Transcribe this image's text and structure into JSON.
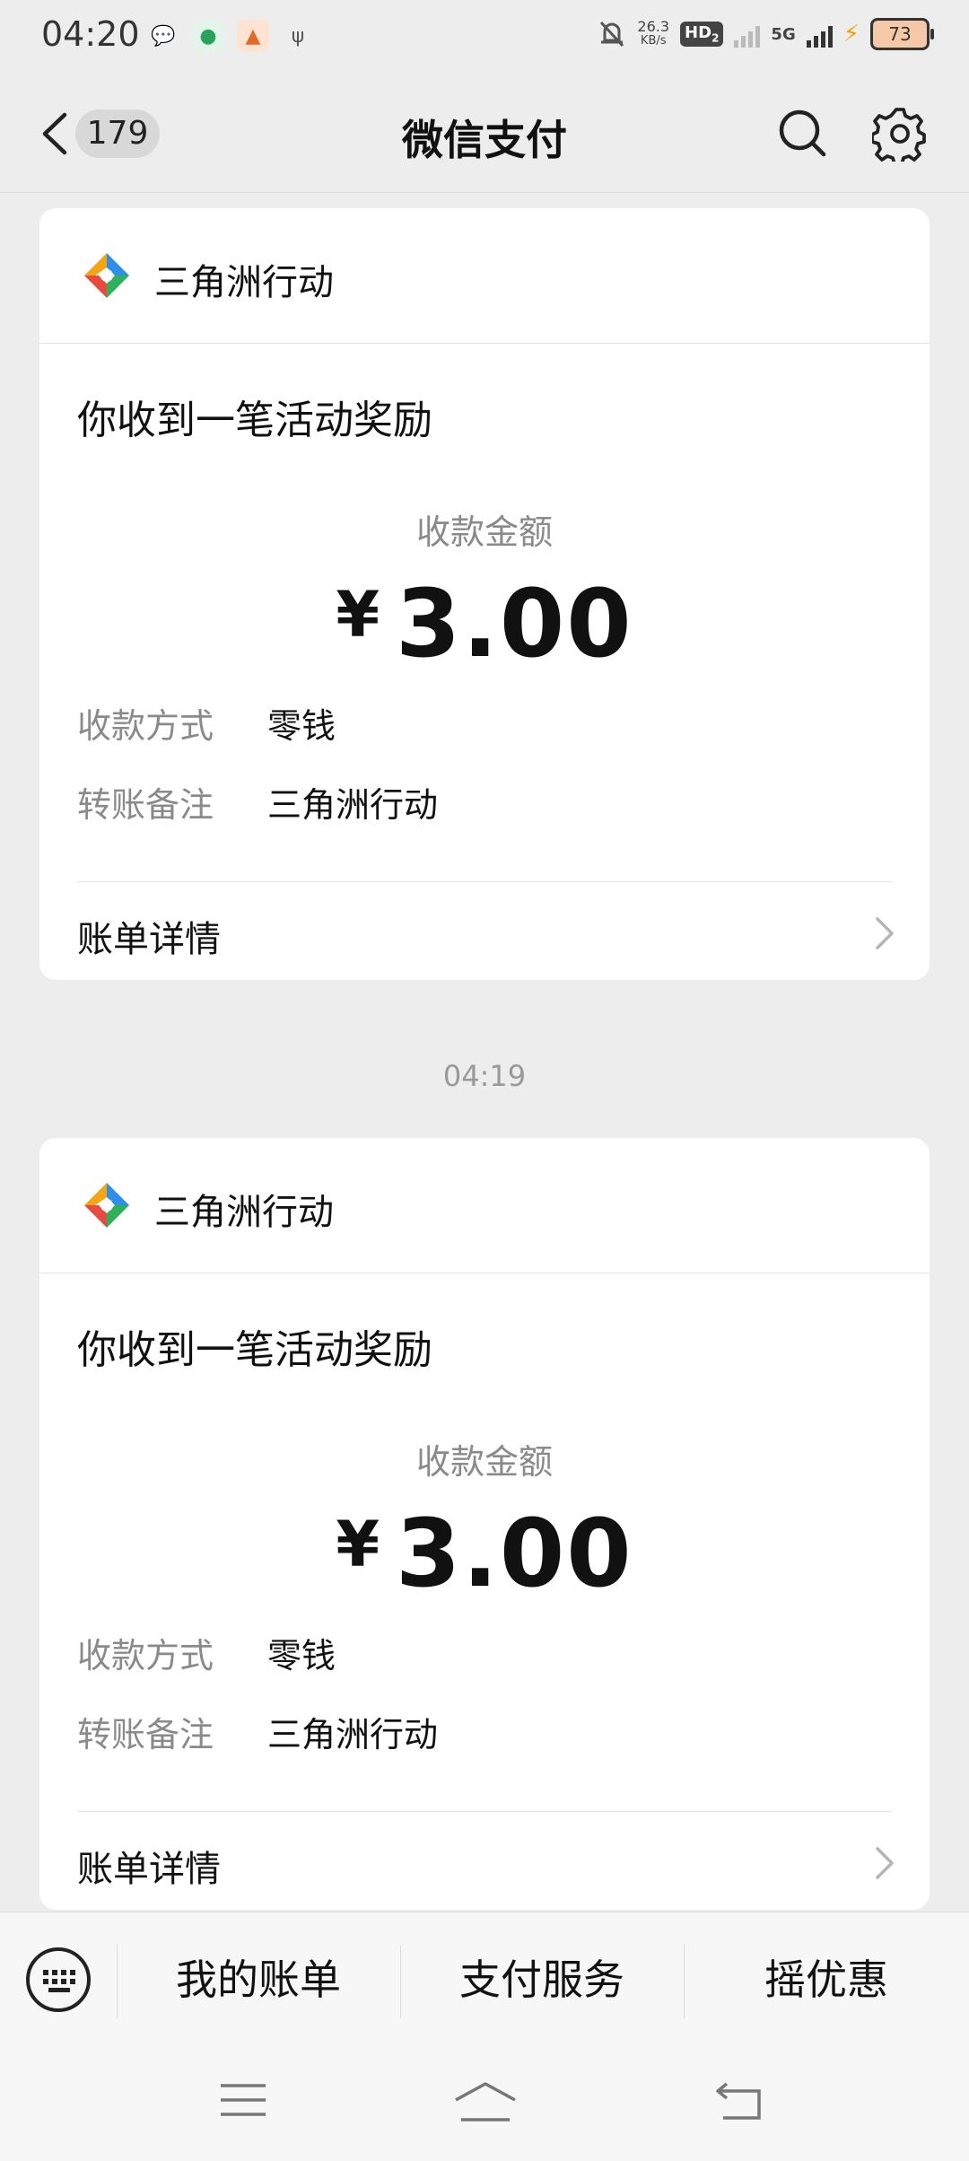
{
  "status_bar": {
    "time": "04:20",
    "net_speed_value": "26.3",
    "net_speed_unit": "KB/s",
    "hd_label": "HD",
    "hd_sub": "2",
    "network": "5G",
    "battery": "73"
  },
  "nav": {
    "unread_count": "179",
    "title": "微信支付"
  },
  "messages": [
    {
      "brand": "三角洲行动",
      "headline": "你收到一笔活动奖励",
      "amount_label": "收款金额",
      "currency": "¥",
      "amount": "3.00",
      "method_key": "收款方式",
      "method_value": "零钱",
      "note_key": "转账备注",
      "note_value": "三角洲行动",
      "detail_label": "账单详情"
    },
    {
      "brand": "三角洲行动",
      "headline": "你收到一笔活动奖励",
      "amount_label": "收款金额",
      "currency": "¥",
      "amount": "3.00",
      "method_key": "收款方式",
      "method_value": "零钱",
      "note_key": "转账备注",
      "note_value": "三角洲行动",
      "detail_label": "账单详情"
    }
  ],
  "timestamp_divider": "04:19",
  "bottom_menu": {
    "items": [
      "我的账单",
      "支付服务",
      "摇优惠"
    ]
  },
  "colors": {
    "background": "#ededed",
    "card": "#ffffff",
    "secondary_text": "#8a8a8a"
  }
}
